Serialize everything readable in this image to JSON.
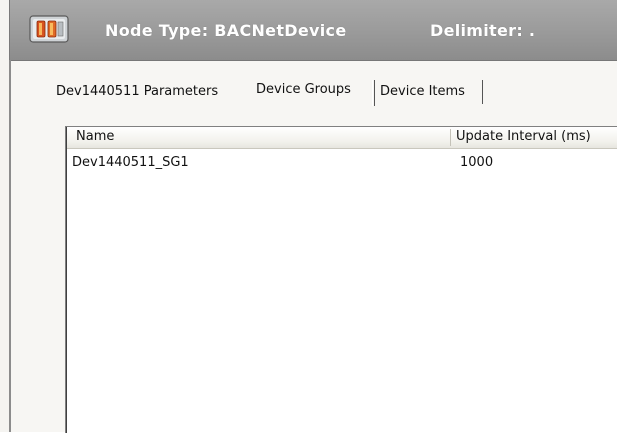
{
  "header": {
    "node_type": "Node Type: BACNetDevice",
    "delimiter": "Delimiter: ."
  },
  "tabs": [
    {
      "label": "Dev1440511 Parameters",
      "active": false
    },
    {
      "label": "Device Groups",
      "active": true
    },
    {
      "label": "Device Items",
      "active": false
    }
  ],
  "table": {
    "columns": [
      "Name",
      "Update Interval (ms)"
    ],
    "rows": [
      {
        "name": "Dev1440511_SG1",
        "update_interval": "1000"
      }
    ]
  },
  "icons": {
    "node": "node-type-icon"
  }
}
